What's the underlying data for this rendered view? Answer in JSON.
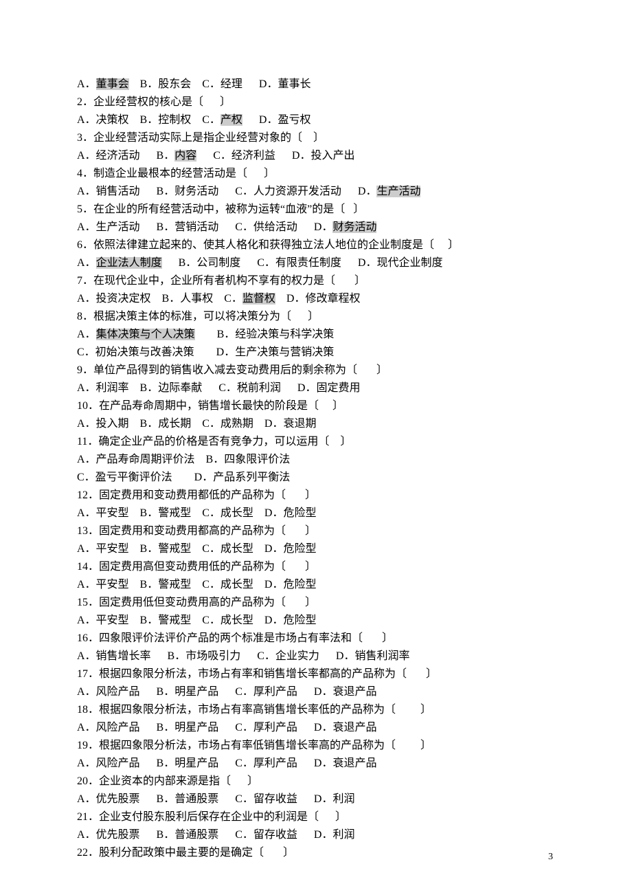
{
  "page_number": "3",
  "lines": [
    {
      "segs": [
        {
          "t": "A．"
        },
        {
          "t": "董事会",
          "hl": true
        },
        {
          "t": "    B．股东会    C．经理      D．董事长"
        }
      ]
    },
    {
      "segs": [
        {
          "t": "2．企业经营权的核心是〔      〕"
        }
      ]
    },
    {
      "segs": [
        {
          "t": "A．决策权    B．控制权    C．"
        },
        {
          "t": "产权",
          "hl": true
        },
        {
          "t": "      D．盈亏权"
        }
      ]
    },
    {
      "segs": [
        {
          "t": "3．企业经营活动实际上是指企业经营对象的〔    〕"
        }
      ]
    },
    {
      "segs": [
        {
          "t": "A．经济活动      B．"
        },
        {
          "t": "内容",
          "hl": true
        },
        {
          "t": "      C．经济利益      D．投入产出"
        }
      ]
    },
    {
      "segs": [
        {
          "t": "4．制造企业最根本的经营活动是〔      〕"
        }
      ]
    },
    {
      "segs": [
        {
          "t": "A．销售活动      B．财务活动      C．人力资源开发活动      D．"
        },
        {
          "t": "生产活动",
          "hl": true
        }
      ]
    },
    {
      "segs": [
        {
          "t": "5．在企业的所有经营活动中，被称为运转“血液”的是〔   〕"
        }
      ]
    },
    {
      "segs": [
        {
          "t": "A．生产活动      B．营销活动      C．供给活动      D．"
        },
        {
          "t": "财务活动",
          "hl": true
        }
      ]
    },
    {
      "segs": [
        {
          "t": "6．依照法律建立起来的、使其人格化和获得独立法人地位的企业制度是〔     〕"
        }
      ]
    },
    {
      "segs": [
        {
          "t": "A．"
        },
        {
          "t": "企业法人制度",
          "hl": true
        },
        {
          "t": "      B．公司制度      C．有限责任制度      D．现代企业制度"
        }
      ]
    },
    {
      "segs": [
        {
          "t": "7．在现代企业中，企业所有者机构不享有的权力是〔       〕"
        }
      ]
    },
    {
      "segs": [
        {
          "t": "A．投资决定权    B．人事权    C．"
        },
        {
          "t": "监督权",
          "hl": true
        },
        {
          "t": "    D．修改章程权"
        }
      ]
    },
    {
      "segs": [
        {
          "t": "8．根据决策主体的标准，可以将决策分为〔      〕"
        }
      ]
    },
    {
      "segs": [
        {
          "t": "A．"
        },
        {
          "t": "集体决策与个人决策",
          "hl": true
        },
        {
          "t": "        B．经验决策与科学决策"
        }
      ]
    },
    {
      "segs": [
        {
          "t": "C．初始决策与改善决策        D．生产决策与营销决策"
        }
      ]
    },
    {
      "segs": [
        {
          "t": "9．单位产品得到的销售收入减去变动费用后的剩余称为〔       〕"
        }
      ]
    },
    {
      "segs": [
        {
          "t": "A．利润率    B．边际奉献      C．税前利润      D．固定费用"
        }
      ]
    },
    {
      "segs": [
        {
          "t": "10．在产品寿命周期中，销售增长最快的阶段是〔     〕"
        }
      ]
    },
    {
      "segs": [
        {
          "t": "A．投入期    B．成长期    C．成熟期    D．衰退期"
        }
      ]
    },
    {
      "segs": [
        {
          "t": "11．确定企业产品的价格是否有竞争力，可以运用〔    〕"
        }
      ]
    },
    {
      "segs": [
        {
          "t": "A．产品寿命周期评价法    B．四象限评价法"
        }
      ]
    },
    {
      "segs": [
        {
          "t": "C．盈亏平衡评价法        D．产品系列平衡法"
        }
      ]
    },
    {
      "segs": [
        {
          "t": "12．固定费用和变动费用都低的产品称为〔       〕"
        }
      ]
    },
    {
      "segs": [
        {
          "t": "A．平安型    B．警戒型    C．成长型    D．危险型"
        }
      ]
    },
    {
      "segs": [
        {
          "t": "13．固定费用和变动费用都高的产品称为〔       〕"
        }
      ]
    },
    {
      "segs": [
        {
          "t": "A．平安型    B．警戒型    C．成长型    D．危险型"
        }
      ]
    },
    {
      "segs": [
        {
          "t": "14．固定费用高但变动费用低的产品称为〔       〕"
        }
      ]
    },
    {
      "segs": [
        {
          "t": "A．平安型    B．警戒型    C．成长型    D．危险型"
        }
      ]
    },
    {
      "segs": [
        {
          "t": "15．固定费用低但变动费用高的产品称为〔       〕"
        }
      ]
    },
    {
      "segs": [
        {
          "t": "A．平安型    B．警戒型    C．成长型    D．危险型"
        }
      ]
    },
    {
      "segs": [
        {
          "t": "16．四象限评价法评价产品的两个标准是市场占有率法和〔       〕"
        }
      ]
    },
    {
      "segs": [
        {
          "t": "A．销售增长率      B．市场吸引力      C．企业实力      D．销售利润率"
        }
      ]
    },
    {
      "segs": [
        {
          "t": "17．根据四象限分析法，市场占有率和销售增长率都高的产品称为〔       〕"
        }
      ]
    },
    {
      "segs": [
        {
          "t": "A．风险产品      B．明星产品      C．厚利产品      D．衰退产品"
        }
      ]
    },
    {
      "segs": [
        {
          "t": "18．根据四象限分析法，市场占有率高销售增长率低的产品称为〔         〕"
        }
      ]
    },
    {
      "segs": [
        {
          "t": "A．风险产品      B．明星产品      C．厚利产品      D．衰退产品"
        }
      ]
    },
    {
      "segs": [
        {
          "t": "19．根据四象限分析法，市场占有率低销售增长率高的产品称为〔         〕"
        }
      ]
    },
    {
      "segs": [
        {
          "t": "A．风险产品      B．明星产品      C．厚利产品      D．衰退产品"
        }
      ]
    },
    {
      "segs": [
        {
          "t": "20．企业资本的内部来源是指〔      〕"
        }
      ]
    },
    {
      "segs": [
        {
          "t": "A．优先股票      B．普通股票      C．留存收益      D．利润"
        }
      ]
    },
    {
      "segs": [
        {
          "t": "21．企业支付股东股利后保存在企业中的利润是〔      〕"
        }
      ]
    },
    {
      "segs": [
        {
          "t": "A．优先股票      B．普通股票      C．留存收益      D．利润"
        }
      ]
    },
    {
      "segs": [
        {
          "t": "22．股利分配政策中最主要的是确定〔       〕"
        }
      ]
    }
  ]
}
